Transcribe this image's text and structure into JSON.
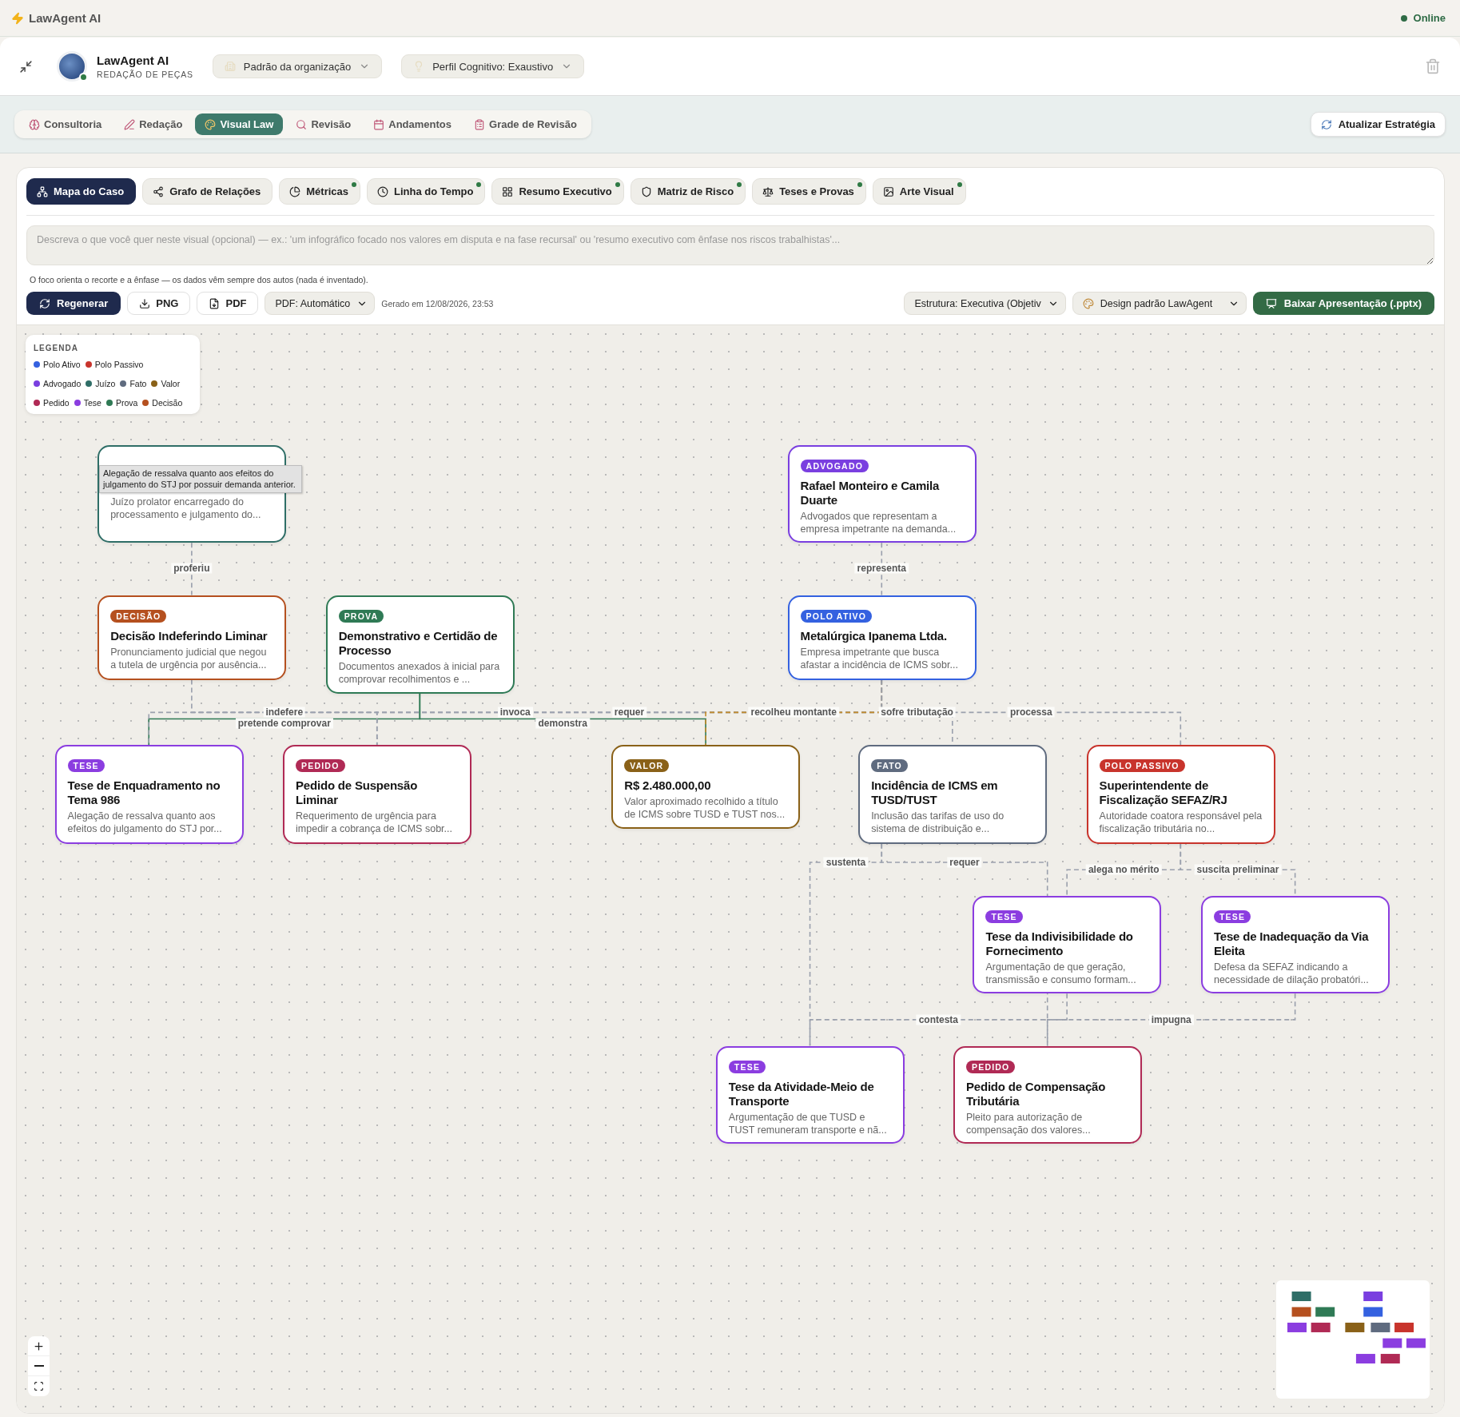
{
  "app_bar": {
    "title": "LawAgent AI",
    "status": "Online"
  },
  "header": {
    "name": "LawAgent AI",
    "subtitle": "REDAÇÃO DE PEÇAS",
    "dropdowns": [
      "Padrão da organização",
      "Perfil Cognitivo: Exaustivo"
    ]
  },
  "tabs": [
    {
      "label": "Consultoria",
      "selected": false
    },
    {
      "label": "Redação",
      "selected": false
    },
    {
      "label": "Visual Law",
      "selected": true
    },
    {
      "label": "Revisão",
      "selected": false
    },
    {
      "label": "Andamentos",
      "selected": false
    },
    {
      "label": "Grade de Revisão",
      "selected": false
    }
  ],
  "update_button": "Atualizar Estratégia",
  "view_tabs": [
    {
      "label": "Mapa do Caso",
      "selected": true,
      "has_update": false
    },
    {
      "label": "Grafo de Relações",
      "selected": false,
      "has_update": false
    },
    {
      "label": "Métricas",
      "selected": false,
      "has_update": true
    },
    {
      "label": "Linha do Tempo",
      "selected": false,
      "has_update": true
    },
    {
      "label": "Resumo Executivo",
      "selected": false,
      "has_update": true
    },
    {
      "label": "Matriz de Risco",
      "selected": false,
      "has_update": true
    },
    {
      "label": "Teses e Provas",
      "selected": false,
      "has_update": true
    },
    {
      "label": "Arte Visual",
      "selected": false,
      "has_update": true
    }
  ],
  "focus_field": {
    "placeholder": "Descreva o que você quer neste visual (opcional) — ex.: 'um infográfico focado nos valores em disputa e na fase recursal' ou 'resumo executivo com ênfase nos riscos trabalhistas'..."
  },
  "focus_note": "O foco orienta o recorte e a ênfase — os dados vêm sempre dos autos (nada é inventado).",
  "actions": {
    "regenerate": "Regenerar",
    "png": "PNG",
    "pdf": "PDF",
    "pdf_mode": "PDF: Automático",
    "generated": "Gerado em 12/08/2026, 23:53",
    "structure": "Estrutura: Executiva (Objetiv",
    "design": "Design padrão LawAgent",
    "download": "Baixar Apresentação (.pptx)"
  },
  "legend": {
    "title": "LEGENDA",
    "items": [
      {
        "label": "Polo Ativo",
        "color": "#3461e0"
      },
      {
        "label": "Polo Passivo",
        "color": "#c8342c"
      },
      {
        "label": "Advogado",
        "color": "#7a3fe0"
      },
      {
        "label": "Juízo",
        "color": "#2f6e67"
      },
      {
        "label": "Fato",
        "color": "#5f6b7f"
      },
      {
        "label": "Valor",
        "color": "#8a6118"
      },
      {
        "label": "Pedido",
        "color": "#b02a55"
      },
      {
        "label": "Tese",
        "color": "#8b3de0"
      },
      {
        "label": "Prova",
        "color": "#2f7a55"
      },
      {
        "label": "Decisão",
        "color": "#b5501f"
      }
    ]
  },
  "nodes": [
    {
      "kind": "juizo",
      "description": "Juízo prolator encarregado do processamento e julgamento do..."
    },
    {
      "kind": "advogado",
      "badge": "ADVOGADO",
      "title": "Rafael Monteiro e Camila Duarte",
      "description": "Advogados que representam a empresa impetrante na demanda..."
    },
    {
      "kind": "decisao",
      "badge": "DECISÃO",
      "title": "Decisão Indeferindo Liminar",
      "description": "Pronunciamento judicial que negou a tutela de urgência por ausência..."
    },
    {
      "kind": "prova",
      "badge": "PROVA",
      "title": "Demonstrativo e Certidão de Processo",
      "description": "Documentos anexados à inicial para comprovar recolhimentos e ..."
    },
    {
      "kind": "polo_ativo",
      "badge": "POLO ATIVO",
      "title": "Metalúrgica Ipanema Ltda.",
      "description": "Empresa impetrante que busca afastar a incidência de ICMS sobr..."
    },
    {
      "kind": "tese",
      "badge": "TESE",
      "title": "Tese de Enquadramento no Tema 986",
      "description": "Alegação de ressalva quanto aos efeitos do julgamento do STJ por..."
    },
    {
      "kind": "pedido",
      "badge": "PEDIDO",
      "title": "Pedido de Suspensão Liminar",
      "description": "Requerimento de urgência para impedir a cobrança de ICMS sobr..."
    },
    {
      "kind": "valor",
      "badge": "VALOR",
      "title": "R$ 2.480.000,00",
      "description": "Valor aproximado recolhido a título de ICMS sobre TUSD e TUST nos..."
    },
    {
      "kind": "fato",
      "badge": "FATO",
      "title": "Incidência de ICMS em TUSD/TUST",
      "description": "Inclusão das tarifas de uso do sistema de distribuição e..."
    },
    {
      "kind": "polo_passivo",
      "badge": "POLO PASSIVO",
      "title": "Superintendente de Fiscalização SEFAZ/RJ",
      "description": "Autoridade coatora responsável pela fiscalização tributária no..."
    },
    {
      "kind": "tese",
      "badge": "TESE",
      "title": "Tese da Indivisibilidade do Fornecimento",
      "description": "Argumentação de que geração, transmissão e consumo formam..."
    },
    {
      "kind": "tese",
      "badge": "TESE",
      "title": "Tese de Inadequação da Via Eleita",
      "description": "Defesa da SEFAZ indicando a necessidade de dilação probatóri..."
    },
    {
      "kind": "tese",
      "badge": "TESE",
      "title": "Tese da Atividade-Meio de Transporte",
      "description": "Argumentação de que TUSD e TUST remuneram transporte e nã..."
    },
    {
      "kind": "pedido",
      "badge": "PEDIDO",
      "title": "Pedido de Compensação Tributária",
      "description": "Pleito para autorização de compensação dos valores..."
    }
  ],
  "edges": [
    {
      "label": "proferiu"
    },
    {
      "label": "representa"
    },
    {
      "label": "indefere"
    },
    {
      "label": "pretende comprovar"
    },
    {
      "label": "invoca"
    },
    {
      "label": "demonstra"
    },
    {
      "label": "requer"
    },
    {
      "label": "recolheu montante"
    },
    {
      "label": "sofre tributação"
    },
    {
      "label": "processa"
    },
    {
      "label": "sustenta"
    },
    {
      "label": "requer"
    },
    {
      "label": "alega no mérito"
    },
    {
      "label": "suscita preliminar"
    },
    {
      "label": "contesta"
    },
    {
      "label": "impugna"
    }
  ],
  "tooltip": "Alegação de ressalva quanto aos efeitos do julgamento do STJ por possuir demanda anterior."
}
